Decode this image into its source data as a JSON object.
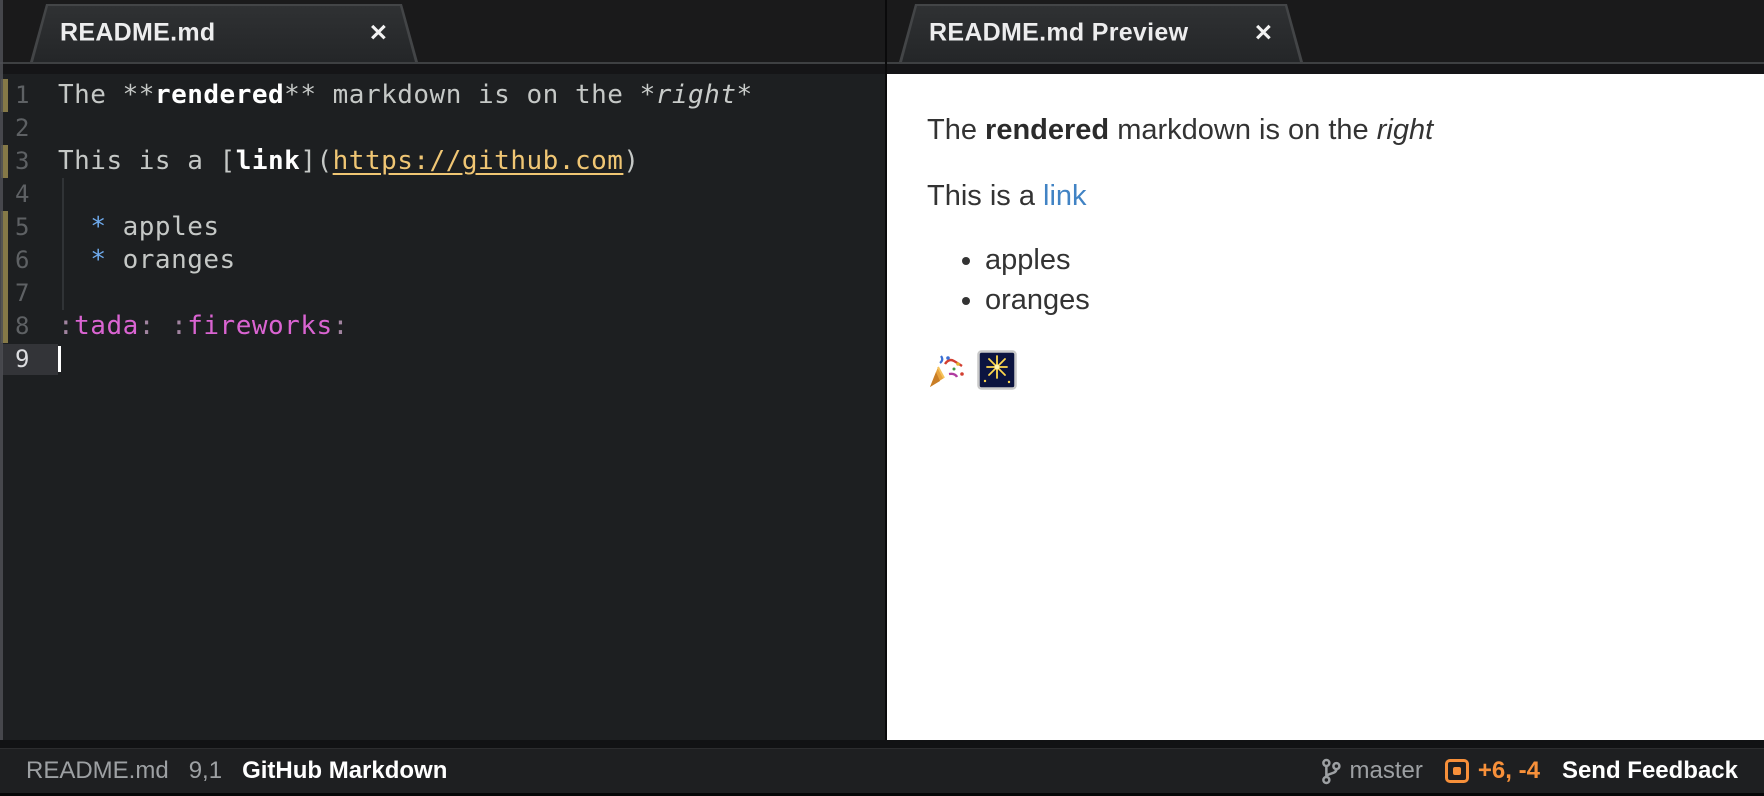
{
  "tabs": {
    "editor": {
      "title": "README.md",
      "close_glyph": "✕"
    },
    "preview": {
      "title": "README.md Preview",
      "close_glyph": "✕"
    }
  },
  "editor": {
    "lines": [
      {
        "num": 1,
        "git": true,
        "current": false,
        "segments": [
          {
            "s": "plain",
            "t": "The "
          },
          {
            "s": "punct",
            "t": "**"
          },
          {
            "s": "bold",
            "t": "rendered"
          },
          {
            "s": "punct",
            "t": "**"
          },
          {
            "s": "plain",
            "t": " markdown is on the "
          },
          {
            "s": "italic",
            "t": "*right*"
          }
        ]
      },
      {
        "num": 2,
        "git": false,
        "current": false,
        "segments": []
      },
      {
        "num": 3,
        "git": true,
        "current": false,
        "segments": [
          {
            "s": "plain",
            "t": "This is a "
          },
          {
            "s": "punct",
            "t": "["
          },
          {
            "s": "bold",
            "t": "link"
          },
          {
            "s": "punct",
            "t": "]("
          },
          {
            "s": "url",
            "t": "https://github.com"
          },
          {
            "s": "punct",
            "t": ")"
          }
        ]
      },
      {
        "num": 4,
        "git": false,
        "current": false,
        "segments": []
      },
      {
        "num": 5,
        "git": true,
        "current": false,
        "segments": [
          {
            "s": "plain",
            "t": "  "
          },
          {
            "s": "bullet",
            "t": "*"
          },
          {
            "s": "plain",
            "t": " apples"
          }
        ]
      },
      {
        "num": 6,
        "git": true,
        "current": false,
        "segments": [
          {
            "s": "plain",
            "t": "  "
          },
          {
            "s": "bullet",
            "t": "*"
          },
          {
            "s": "plain",
            "t": " oranges"
          }
        ]
      },
      {
        "num": 7,
        "git": true,
        "current": false,
        "segments": []
      },
      {
        "num": 8,
        "git": true,
        "current": false,
        "segments": [
          {
            "s": "colon",
            "t": ":"
          },
          {
            "s": "emoji",
            "t": "tada"
          },
          {
            "s": "colon",
            "t": ":"
          },
          {
            "s": "plain",
            "t": " "
          },
          {
            "s": "colon",
            "t": ":"
          },
          {
            "s": "emoji",
            "t": "fireworks"
          },
          {
            "s": "colon",
            "t": ":"
          }
        ]
      },
      {
        "num": 9,
        "git": false,
        "current": true,
        "cursor": true,
        "segments": []
      }
    ]
  },
  "preview": {
    "paragraphs": [
      {
        "id": "p1",
        "segments": [
          {
            "t": "The "
          },
          {
            "t": "rendered",
            "style": "bold"
          },
          {
            "t": " markdown is on the "
          },
          {
            "t": "right",
            "style": "italic"
          }
        ]
      },
      {
        "id": "p2",
        "segments": [
          {
            "t": "This is a "
          },
          {
            "t": "link",
            "style": "link"
          }
        ]
      }
    ],
    "list_items": [
      "apples",
      "oranges"
    ],
    "emoji": [
      {
        "name": "tada-emoji",
        "char": "🎉"
      },
      {
        "name": "fireworks-emoji",
        "char": "🎆"
      }
    ]
  },
  "status": {
    "left": {
      "file": "README.md",
      "position": "9,1",
      "grammar": "GitHub Markdown"
    },
    "right": {
      "branch": "master",
      "diff": "+6, -4",
      "feedback": "Send Feedback"
    }
  },
  "colors": {
    "accent_orange": "#f7903a",
    "url_yellow": "#f0c674",
    "bullet_blue": "#6fabee",
    "emoji_pink": "#da64d2",
    "preview_link_blue": "#4183c4",
    "git_gutter_modified": "#857947",
    "editor_background": "#1d1f21"
  }
}
